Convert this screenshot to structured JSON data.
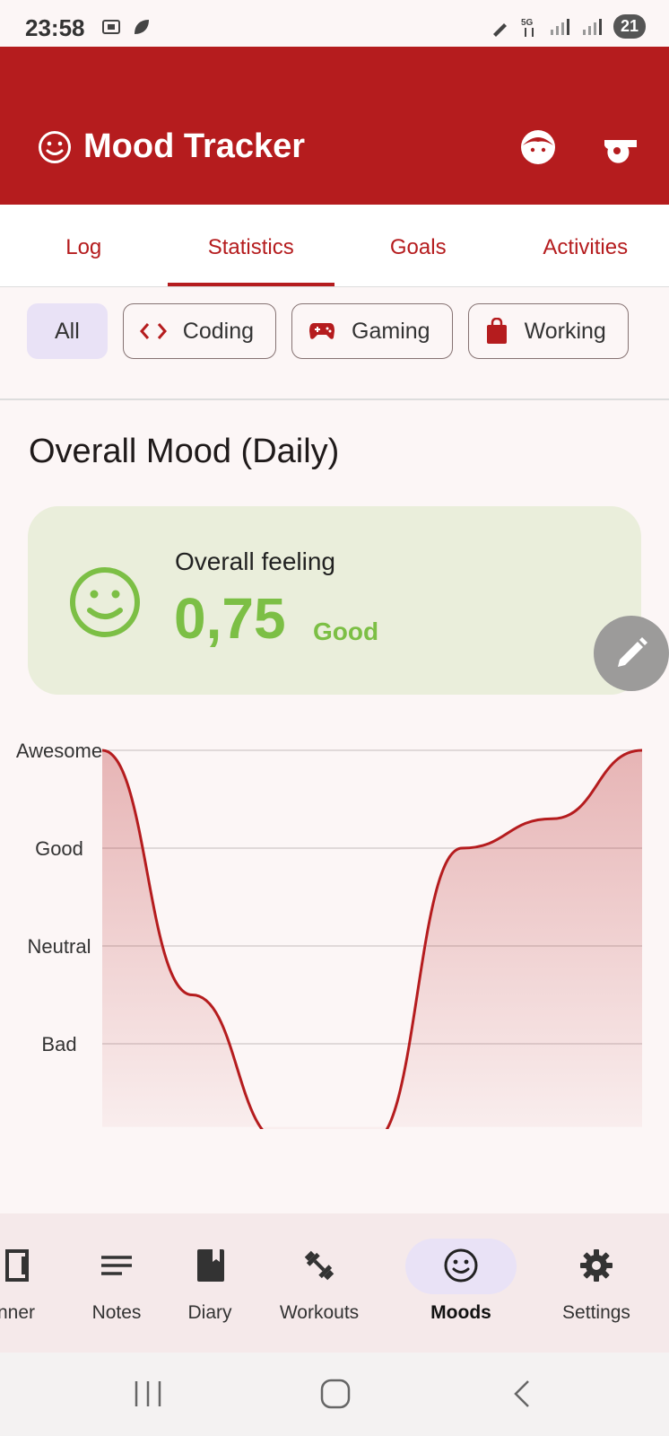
{
  "status": {
    "time": "23:58",
    "battery": "21",
    "network": "5G"
  },
  "appbar": {
    "title": "Mood Tracker",
    "icons": [
      "smiley-icon",
      "person-face-icon",
      "whistle-icon"
    ]
  },
  "tabs": [
    {
      "label": "Log"
    },
    {
      "label": "Statistics",
      "active": true
    },
    {
      "label": "Goals"
    },
    {
      "label": "Activities"
    }
  ],
  "filters": {
    "selected": "All",
    "chips": [
      {
        "label": "All",
        "icon": ""
      },
      {
        "label": "Coding",
        "icon": "code-icon"
      },
      {
        "label": "Gaming",
        "icon": "gamepad-icon"
      },
      {
        "label": "Working",
        "icon": "shopping-bag-icon"
      }
    ]
  },
  "section": {
    "title": "Overall Mood (Daily)"
  },
  "summary": {
    "label": "Overall feeling",
    "value": "0,75",
    "word": "Good",
    "accent": "#7cbf45"
  },
  "chart_data": {
    "type": "area",
    "y_categories": [
      "Bad",
      "Neutral",
      "Good",
      "Awesome"
    ],
    "y_levels": [
      1,
      2,
      3,
      4
    ],
    "ylim": [
      0.15,
      4
    ],
    "x": [
      0,
      1,
      2,
      3,
      4,
      5,
      6
    ],
    "values": [
      4,
      1.5,
      0,
      0,
      3,
      3.3,
      4
    ],
    "color": "#b51c1e",
    "grid": true
  },
  "bottom_nav": [
    {
      "label": "Planner",
      "display": "nner",
      "icon": "planner-icon"
    },
    {
      "label": "Notes",
      "icon": "notes-icon"
    },
    {
      "label": "Diary",
      "icon": "book-icon"
    },
    {
      "label": "Workouts",
      "icon": "dumbbell-icon"
    },
    {
      "label": "Moods",
      "icon": "smiley-icon",
      "active": true
    },
    {
      "label": "Settings",
      "icon": "gear-icon"
    }
  ]
}
